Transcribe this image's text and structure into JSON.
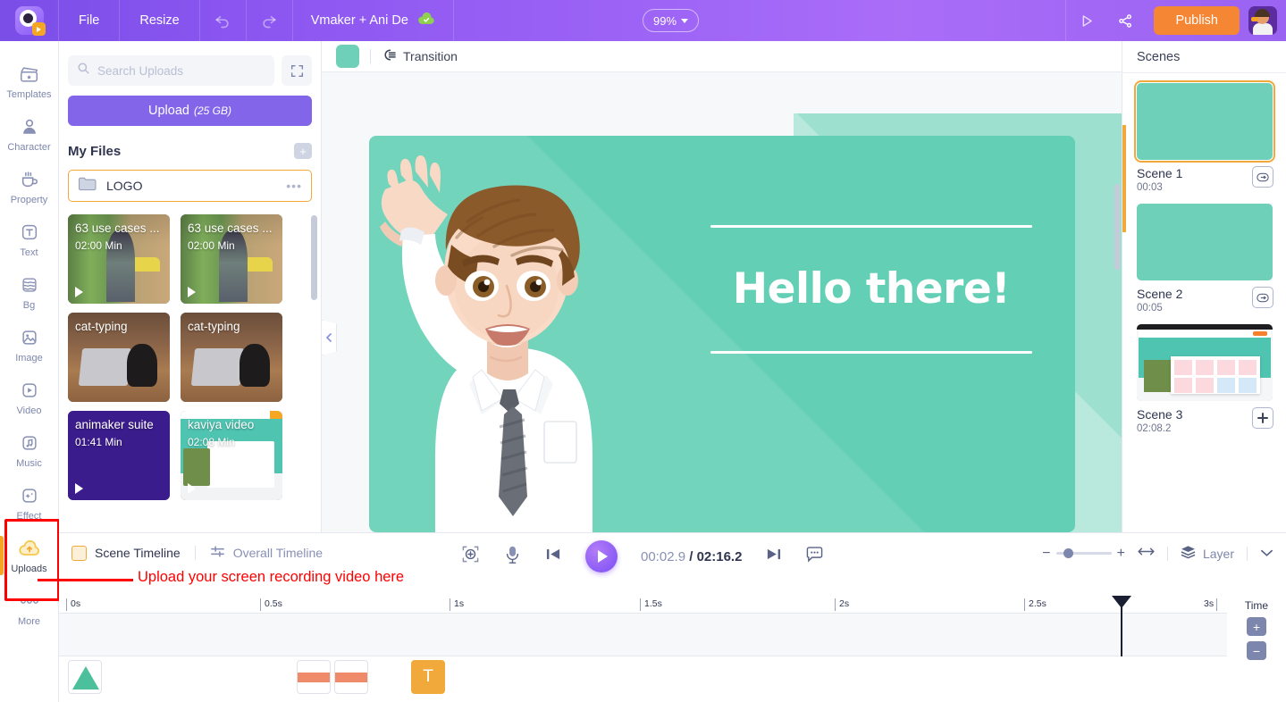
{
  "app": {
    "menus": [
      "File",
      "Resize"
    ],
    "project_title": "Vmaker + Ani De",
    "zoom_level": "99%",
    "publish_label": "Publish",
    "icons": {
      "undo": "undo-icon",
      "redo": "redo-icon",
      "cloud_saved": "cloud-saved-icon",
      "preview": "preview-play-icon",
      "share": "share-icon",
      "avatar": "user-avatar"
    }
  },
  "rail": {
    "items": [
      {
        "label": "Templates",
        "icon": "templates-icon",
        "active": false
      },
      {
        "label": "Character",
        "icon": "character-icon",
        "active": false
      },
      {
        "label": "Property",
        "icon": "property-icon",
        "active": false
      },
      {
        "label": "Text",
        "icon": "text-icon",
        "active": false
      },
      {
        "label": "Bg",
        "icon": "background-icon",
        "active": false
      },
      {
        "label": "Image",
        "icon": "image-icon",
        "active": false
      },
      {
        "label": "Video",
        "icon": "video-icon",
        "active": false
      },
      {
        "label": "Music",
        "icon": "music-icon",
        "active": false
      },
      {
        "label": "Effect",
        "icon": "effect-icon",
        "active": false
      },
      {
        "label": "Uploads",
        "icon": "uploads-cloud-icon",
        "active": true
      },
      {
        "label": "More",
        "icon": "more-dots-icon",
        "active": false
      }
    ]
  },
  "uploads_panel": {
    "search_placeholder": "Search Uploads",
    "search_value": "",
    "expand_icon": "expand-icon",
    "upload_label": "Upload",
    "upload_quota": "(25 GB)",
    "my_files_title": "My Files",
    "add_folder_label": "+",
    "folder": {
      "name": "LOGO",
      "menu": "•••"
    },
    "media": [
      {
        "name": "63 use cases ...",
        "duration": "02:00 Min",
        "art": "art-office",
        "play": true
      },
      {
        "name": "63 use cases ...",
        "duration": "02:00 Min",
        "art": "art-office",
        "play": true
      },
      {
        "name": "cat-typing",
        "duration": "",
        "art": "art-cat",
        "play": false
      },
      {
        "name": "cat-typing",
        "duration": "",
        "art": "art-cat",
        "play": false
      },
      {
        "name": "animaker suite",
        "duration": "01:41 Min",
        "art": "art-purple",
        "play": true
      },
      {
        "name": "kaviya video",
        "duration": "02:08 Min",
        "art": "art-kaviya",
        "play": true
      }
    ]
  },
  "canvas": {
    "transition_label": "Transition",
    "transition_swatch": "#6ed0b8",
    "headline": "Hello there!",
    "bg_color": "#63cfb5",
    "stage_bg": "#9ee0d0",
    "collapse_icon": "chevron-left-icon"
  },
  "scenes_panel": {
    "title": "Scenes",
    "scenes": [
      {
        "name": "Scene 1",
        "duration": "00:03",
        "selected": true,
        "action_icon": "link-scene-icon",
        "art": "plain-teal"
      },
      {
        "name": "Scene 2",
        "duration": "00:05",
        "selected": false,
        "action_icon": "link-scene-icon",
        "art": "plain-teal"
      },
      {
        "name": "Scene 3",
        "duration": "02:08.2",
        "selected": false,
        "action_icon": "add-scene-icon",
        "art": "video-thumb"
      }
    ]
  },
  "timeline": {
    "scene_tab": "Scene Timeline",
    "overall_tab": "Overall Timeline",
    "annotation": "Upload your screen recording video here",
    "annotation_color": "#ff0000",
    "controls": {
      "fit_icon": "fit-to-screen-icon",
      "mic_icon": "record-voice-icon",
      "prev_icon": "previous-frame-icon",
      "play_icon": "play-icon",
      "next_icon": "next-frame-icon",
      "subtitle_icon": "subtitles-icon",
      "resize_icon": "resize-horizontal-icon",
      "layer_label": "Layer",
      "layer_icon": "layers-icon",
      "collapse_icon": "chevron-down-icon",
      "zoom_minus": "−",
      "zoom_plus": "+"
    },
    "current_time": "00:02.9",
    "separator": "/",
    "total_time": "02:16.2",
    "ruler_ticks": [
      "0s",
      "0.5s",
      "1s",
      "1.5s",
      "2s",
      "2.5s",
      "3s"
    ],
    "time_column": {
      "label": "Time",
      "plus": "+",
      "minus": "−"
    },
    "objects": [
      {
        "type": "shape-triangle",
        "name": "timeline-object-triangle"
      },
      {
        "type": "image-stripe",
        "name": "timeline-object-image-1"
      },
      {
        "type": "image-stripe",
        "name": "timeline-object-image-2"
      },
      {
        "type": "text",
        "label": "T",
        "name": "timeline-object-text"
      }
    ]
  }
}
